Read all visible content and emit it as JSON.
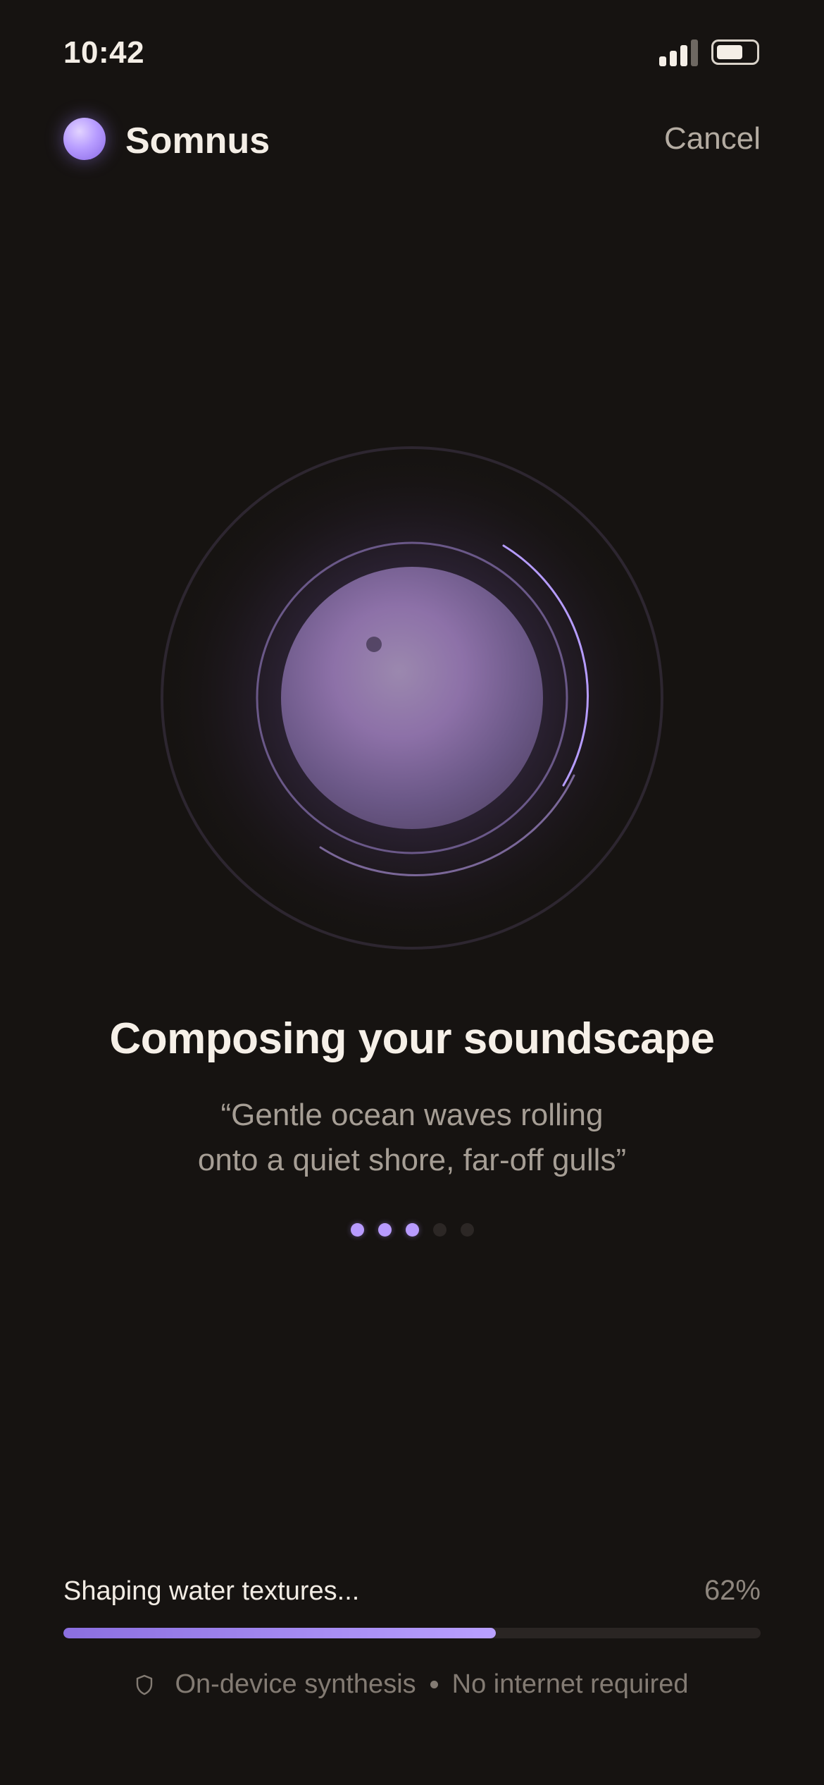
{
  "status_bar": {
    "time": "10:42",
    "signal_icon": "cellular-signal-icon",
    "battery_icon": "battery-icon"
  },
  "header": {
    "app_name": "Somnus",
    "logo_icon": "orb-logo-icon",
    "cancel_label": "Cancel"
  },
  "visualizer": {
    "icon": "sound-orb-visualizer"
  },
  "main": {
    "title": "Composing your soundscape",
    "prompt_line_1": "“Gentle ocean waves rolling",
    "prompt_line_2": "onto a quiet shore, far-off gulls”",
    "steps_total": 5,
    "steps_active": 3
  },
  "progress": {
    "label": "Shaping water textures...",
    "percent_text": "62%",
    "fraction": 0.62
  },
  "footer": {
    "icon": "shield-icon",
    "left_text": "On-device synthesis",
    "right_text": "No internet required"
  },
  "colors": {
    "background": "#161311",
    "accent": "#b89bff",
    "accent_deep": "#8b6fe0",
    "text_primary": "#f2ece4",
    "text_secondary": "#a69e95",
    "text_muted": "#837b73"
  }
}
